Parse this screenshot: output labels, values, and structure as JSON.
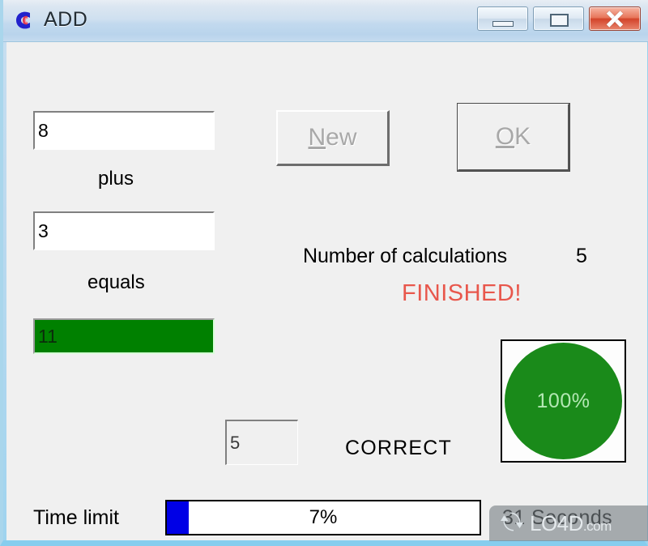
{
  "window": {
    "title": "ADD",
    "icon": "app-c-icon",
    "controls": {
      "minimize": "minimize-icon",
      "maximize": "maximize-icon",
      "close": "close-icon"
    },
    "accent_titlebar": "#c2d9ee",
    "accent_frame": "#9ad3ee",
    "close_button_color": "#d3442b"
  },
  "quiz": {
    "operand1": "8",
    "operator_label": "plus",
    "operand2": "3",
    "equals_label": "equals",
    "answer": "11",
    "answer_field_color": "#008000"
  },
  "buttons": {
    "new": {
      "label_prefix": "",
      "accel": "N",
      "label_suffix": "ew",
      "full": "New",
      "disabled": true
    },
    "ok": {
      "accel": "O",
      "label_suffix": "K",
      "full": "OK",
      "disabled": true
    }
  },
  "stats": {
    "calculations_label": "Number of calculations",
    "calculations_value": "5",
    "finished_label": "FINISHED!",
    "finished_color": "#e8574c",
    "correct_count": "5",
    "correct_label": "CORRECT"
  },
  "pie": {
    "label": "100%",
    "percent": 100,
    "fill_color": "#1a8a1a",
    "text_color": "#b4e8b4"
  },
  "timer": {
    "label": "Time limit",
    "percent_label": "7%",
    "percent": 7,
    "fill_color": "#0000e6",
    "seconds_label": "31  Seconds"
  },
  "watermark": {
    "brand": "LO4D",
    "domain": ".com",
    "icon": "refresh-arrows-icon"
  }
}
